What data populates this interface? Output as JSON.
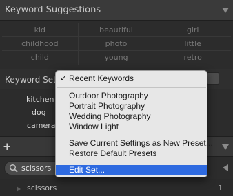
{
  "keyword_suggestions": {
    "title": "Keyword Suggestions",
    "items": [
      "kid",
      "beautiful",
      "girl",
      "childhood",
      "photo",
      "little",
      "child",
      "young",
      "retro"
    ]
  },
  "keyword_set": {
    "label": "Keyword Set",
    "items": [
      "kitchen",
      "dog",
      "camera"
    ]
  },
  "keyword_filter": {
    "value": "scissors"
  },
  "keyword_list": {
    "rows": [
      {
        "name": "scissors",
        "count": "1"
      }
    ]
  },
  "dropdown_menu": {
    "check_mark": "✓",
    "items": [
      "Recent Keywords",
      "Outdoor Photography",
      "Portrait Photography",
      "Wedding Photography",
      "Window Light",
      "Save Current Settings as New Preset...",
      "Restore Default Presets",
      "Edit Set..."
    ],
    "checked_item": "Recent Keywords",
    "highlighted_item": "Edit Set..."
  },
  "colors": {
    "panel_bg": "#2a2a2a",
    "menu_bg": "#e7e7e7",
    "selection": "#2e6ae0"
  }
}
